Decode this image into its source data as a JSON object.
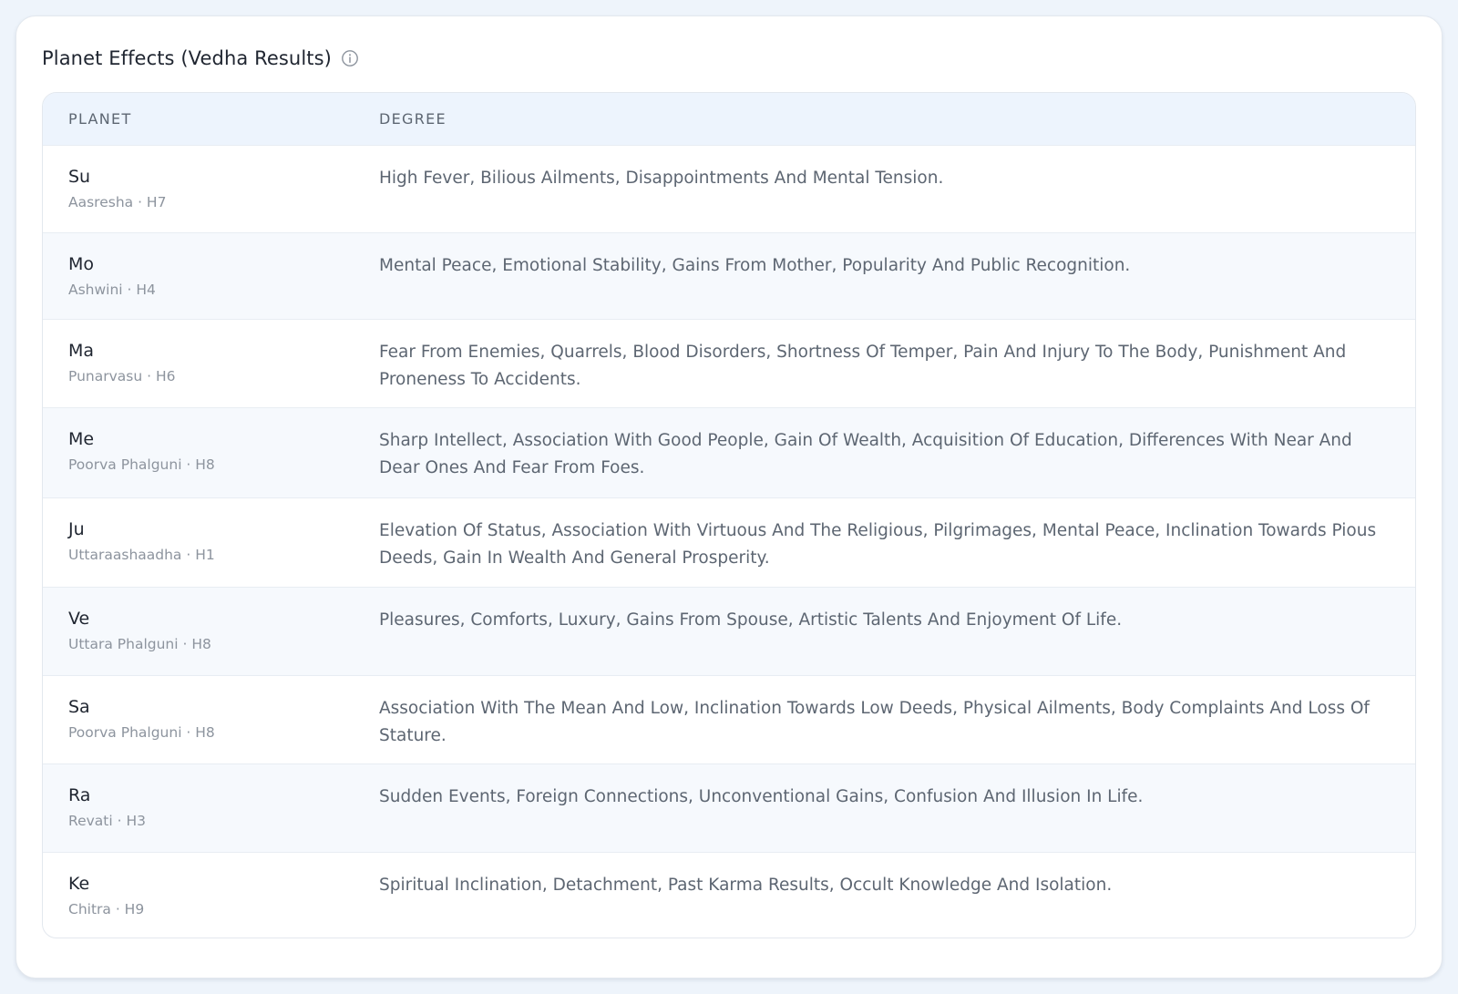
{
  "panel": {
    "title": "Planet Effects (Vedha Results)",
    "info_icon": "info-circle-icon"
  },
  "table": {
    "columns": [
      "PLANET",
      "DEGREE"
    ],
    "rows": [
      {
        "planet": "Su",
        "nakshatra": "Aasresha",
        "house": "H7",
        "meta": "Aasresha · H7",
        "effect": "High Fever, Bilious Ailments, Disappointments And Mental Tension."
      },
      {
        "planet": "Mo",
        "nakshatra": "Ashwini",
        "house": "H4",
        "meta": "Ashwini · H4",
        "effect": "Mental Peace, Emotional Stability, Gains From Mother, Popularity And Public Recognition."
      },
      {
        "planet": "Ma",
        "nakshatra": "Punarvasu",
        "house": "H6",
        "meta": "Punarvasu · H6",
        "effect": "Fear From Enemies, Quarrels, Blood Disorders, Shortness Of Temper, Pain And Injury To The Body, Punishment And Proneness To Accidents."
      },
      {
        "planet": "Me",
        "nakshatra": "Poorva Phalguni",
        "house": "H8",
        "meta": "Poorva Phalguni · H8",
        "effect": "Sharp Intellect, Association With Good People, Gain Of Wealth, Acquisition Of Education, Differences With Near And Dear Ones And Fear From Foes."
      },
      {
        "planet": "Ju",
        "nakshatra": "Uttaraashaadha",
        "house": "H1",
        "meta": "Uttaraashaadha · H1",
        "effect": "Elevation Of Status, Association With Virtuous And The Religious, Pilgrimages, Mental Peace, Inclination Towards Pious Deeds, Gain In Wealth And General Prosperity."
      },
      {
        "planet": "Ve",
        "nakshatra": "Uttara Phalguni",
        "house": "H8",
        "meta": "Uttara Phalguni · H8",
        "effect": "Pleasures, Comforts, Luxury, Gains From Spouse, Artistic Talents And Enjoyment Of Life."
      },
      {
        "planet": "Sa",
        "nakshatra": "Poorva Phalguni",
        "house": "H8",
        "meta": "Poorva Phalguni · H8",
        "effect": "Association With The Mean And Low, Inclination Towards Low Deeds, Physical Ailments, Body Complaints And Loss Of Stature."
      },
      {
        "planet": "Ra",
        "nakshatra": "Revati",
        "house": "H3",
        "meta": "Revati · H3",
        "effect": "Sudden Events, Foreign Connections, Unconventional Gains, Confusion And Illusion In Life."
      },
      {
        "planet": "Ke",
        "nakshatra": "Chitra",
        "house": "H9",
        "meta": "Chitra · H9",
        "effect": "Spiritual Inclination, Detachment, Past Karma Results, Occult Knowledge And Isolation."
      }
    ]
  },
  "colors": {
    "page_background": "#eef4fb",
    "card_background": "#ffffff",
    "header_background": "#edf4fd",
    "alt_row_background": "#f6f9fd",
    "title_text": "#1f2530",
    "body_text": "#5d6672",
    "muted_text": "#8d949e",
    "border": "#e3e8ee"
  }
}
